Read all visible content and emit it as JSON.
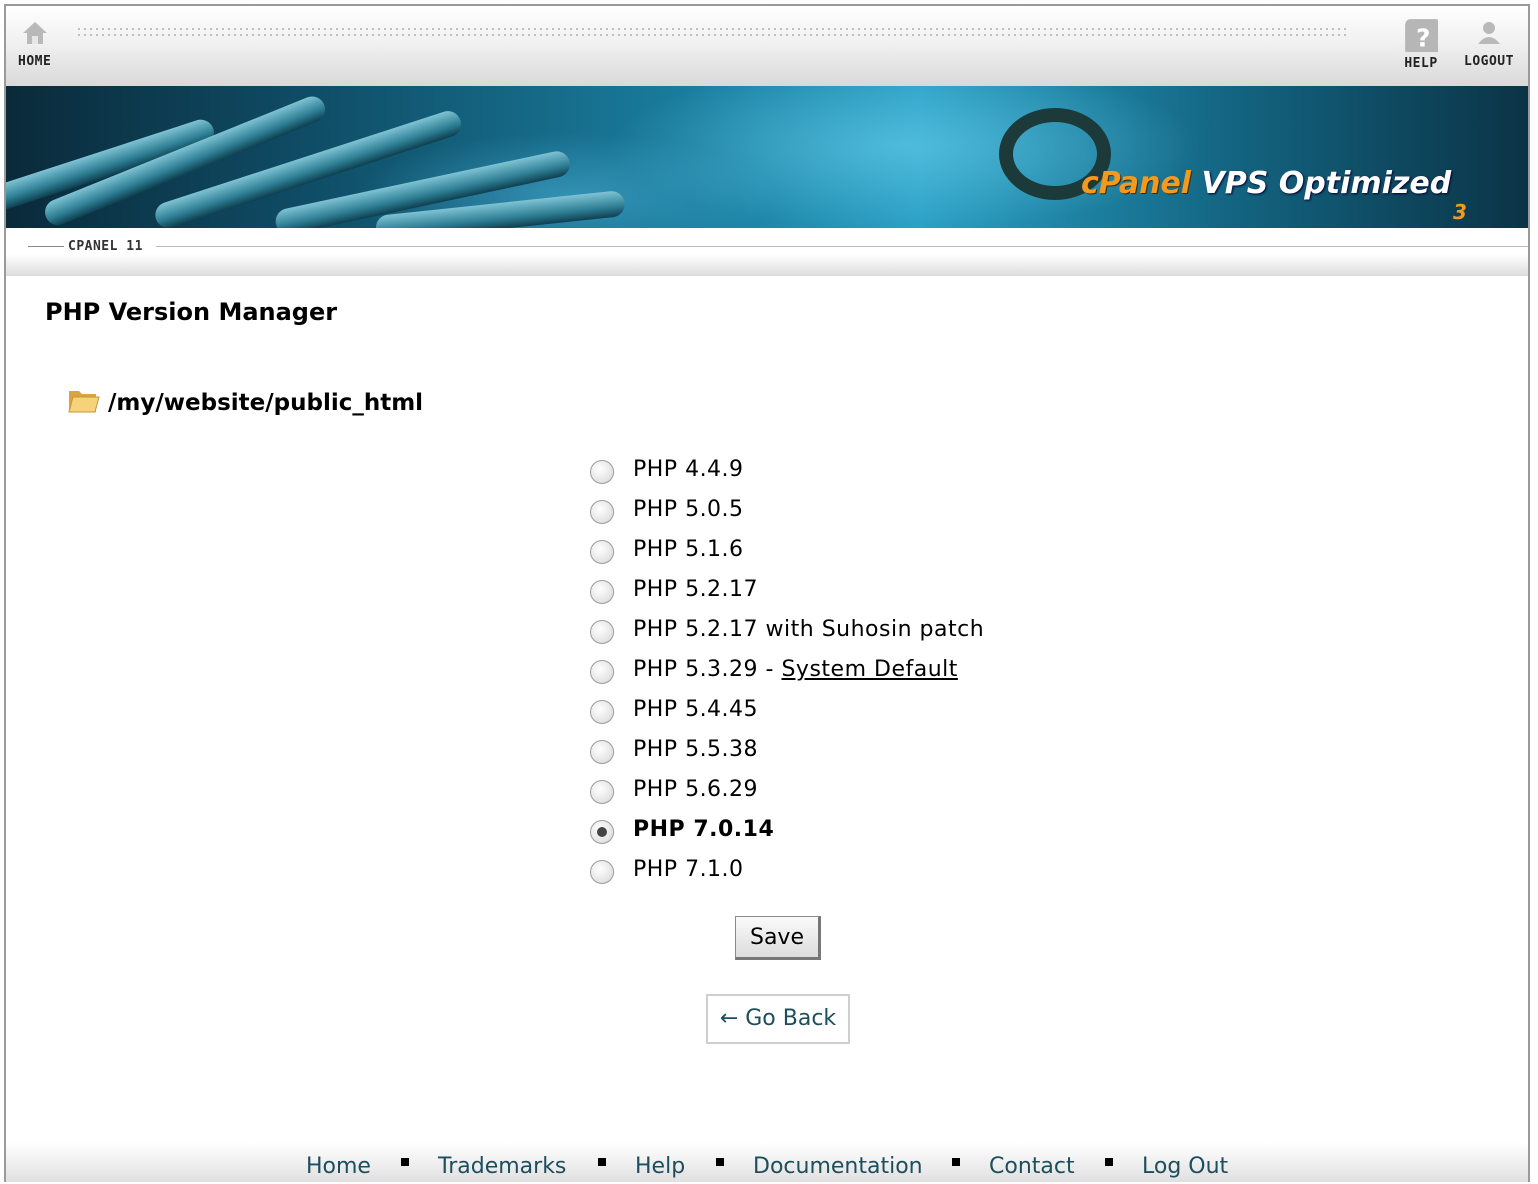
{
  "toolbar": {
    "home_label": "HOME",
    "help_label": "HELP",
    "logout_label": "LOGOUT"
  },
  "banner": {
    "brand_cpanel": "cPanel",
    "brand_rest": " VPS Optimized",
    "brand_sub": "3"
  },
  "strip": {
    "label": "CPANEL 11"
  },
  "page": {
    "title": "PHP Version Manager",
    "path": "/my/website/public_html"
  },
  "versions": [
    {
      "label": "PHP 4.4.9",
      "checked": false
    },
    {
      "label": "PHP 5.0.5",
      "checked": false
    },
    {
      "label": "PHP 5.1.6",
      "checked": false
    },
    {
      "label": "PHP 5.2.17",
      "checked": false
    },
    {
      "label": "PHP 5.2.17 with Suhosin patch",
      "checked": false
    },
    {
      "label": "PHP 5.3.29 - ",
      "suffix": "System Default",
      "checked": false
    },
    {
      "label": "PHP 5.4.45",
      "checked": false
    },
    {
      "label": "PHP 5.5.38",
      "checked": false
    },
    {
      "label": "PHP 5.6.29",
      "checked": false
    },
    {
      "label": "PHP 7.0.14",
      "checked": true
    },
    {
      "label": "PHP 7.1.0",
      "checked": false
    }
  ],
  "actions": {
    "save_label": "Save",
    "go_back_label": "← Go Back"
  },
  "footer": {
    "links": [
      "Home",
      "Trademarks",
      "Help",
      "Documentation",
      "Contact",
      "Log Out"
    ]
  },
  "colors": {
    "link": "#1d4e5e",
    "brand_orange": "#f29a1f"
  }
}
